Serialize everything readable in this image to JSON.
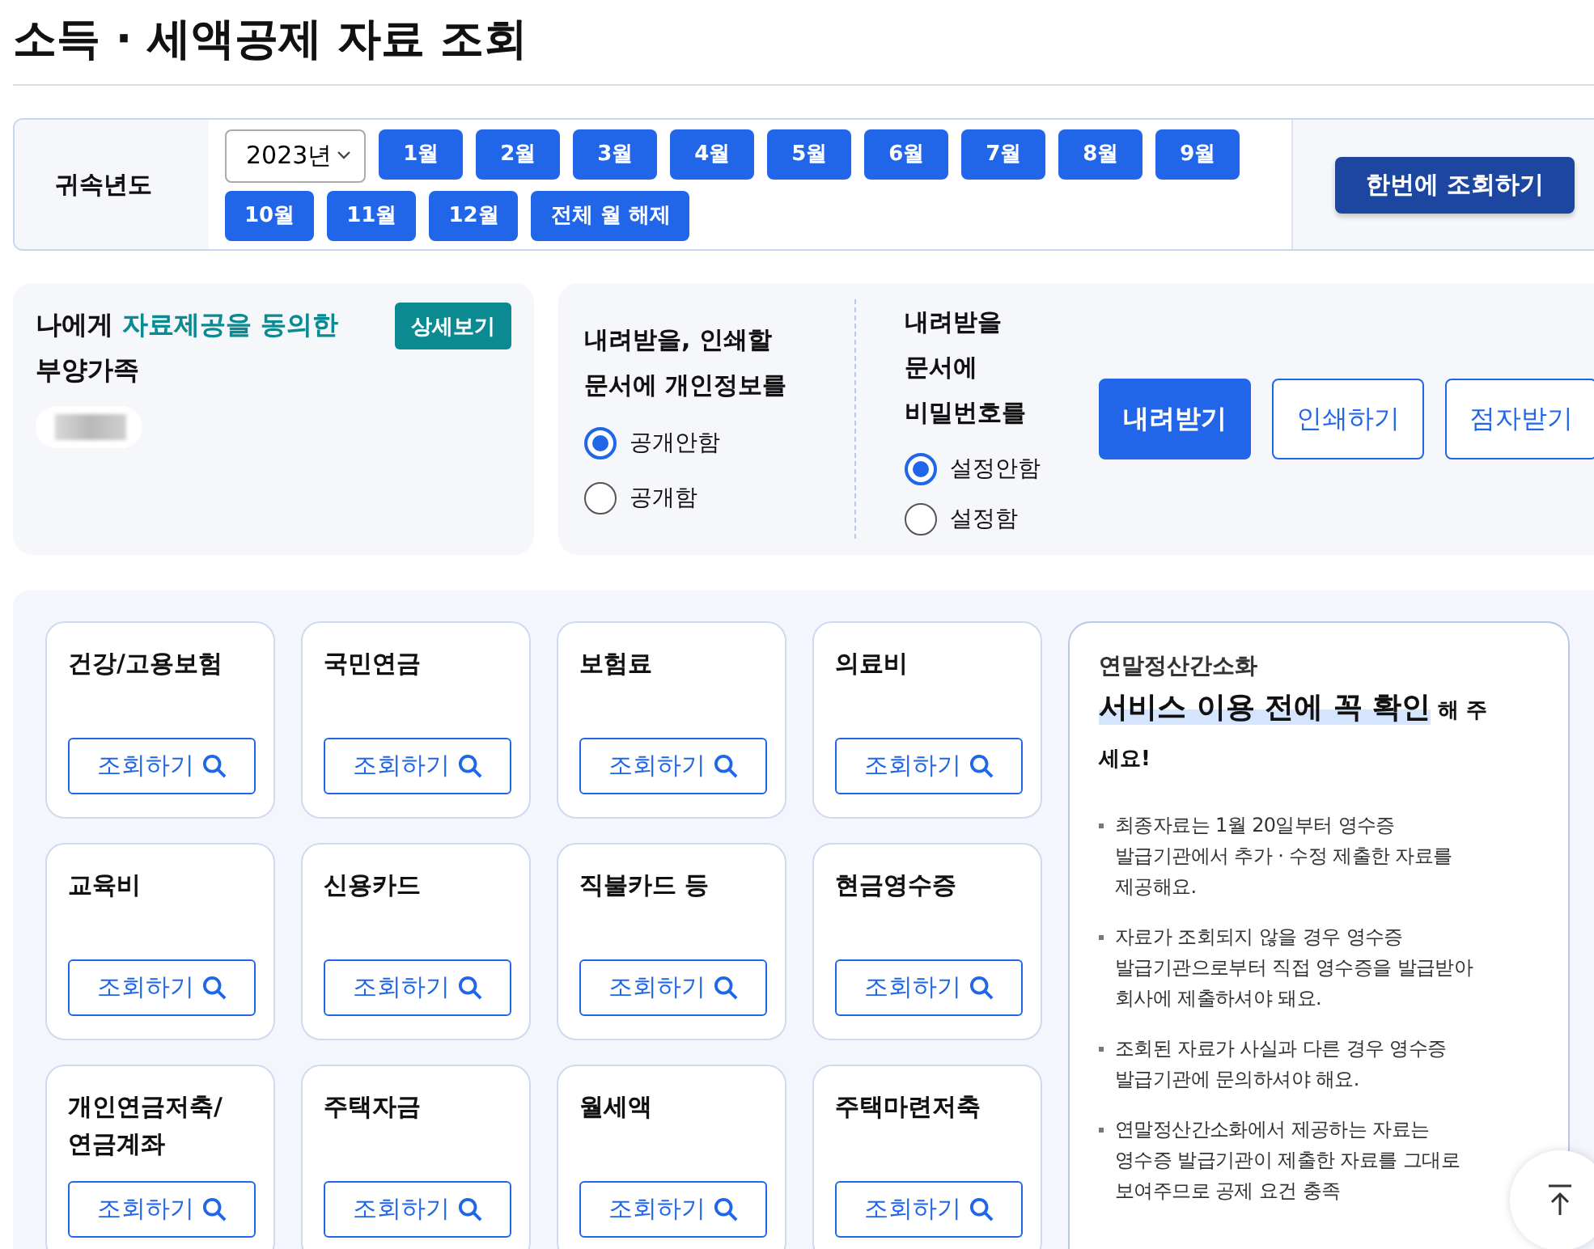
{
  "page_title": "소득 · 세액공제 자료 조회",
  "year_filter": {
    "label": "귀속년도",
    "year": "2023년",
    "months": [
      "1월",
      "2월",
      "3월",
      "4월",
      "5월",
      "6월",
      "7월",
      "8월",
      "9월",
      "10월",
      "11월",
      "12월"
    ],
    "clear_button": "전체 월 해제",
    "search_all_button": "한번에 조회하기"
  },
  "dependents": {
    "title_before": "나에게 ",
    "title_highlight": "자료제공을 동의한",
    "title_after": "부양가족",
    "detail_button": "상세보기"
  },
  "privacy": {
    "question": "내려받을, 인쇄할 문서에 개인정보를",
    "options": [
      {
        "label": "공개안함",
        "selected": true
      },
      {
        "label": "공개함",
        "selected": false
      }
    ]
  },
  "password": {
    "question": "내려받을 문서에 비밀번호를",
    "options": [
      {
        "label": "설정안함",
        "selected": true
      },
      {
        "label": "설정함",
        "selected": false
      }
    ]
  },
  "actions": [
    {
      "label": "내려받기",
      "kind": "primary"
    },
    {
      "label": "인쇄하기",
      "kind": "outline"
    },
    {
      "label": "점자받기",
      "kind": "outline"
    }
  ],
  "categories": [
    {
      "title": "건강/고용보험",
      "button": "조회하기"
    },
    {
      "title": "국민연금",
      "button": "조회하기"
    },
    {
      "title": "보험료",
      "button": "조회하기"
    },
    {
      "title": "의료비",
      "button": "조회하기"
    },
    {
      "title": "교육비",
      "button": "조회하기"
    },
    {
      "title": "신용카드",
      "button": "조회하기"
    },
    {
      "title": "직불카드 등",
      "button": "조회하기"
    },
    {
      "title": "현금영수증",
      "button": "조회하기"
    },
    {
      "title": "개인연금저축/연금계좌",
      "button": "조회하기"
    },
    {
      "title": "주택자금",
      "button": "조회하기"
    },
    {
      "title": "월세액",
      "button": "조회하기"
    },
    {
      "title": "주택마련저축",
      "button": "조회하기"
    }
  ],
  "notice": {
    "subtitle": "연말정산간소화",
    "heading_highlight": "서비스 이용 전에 꼭 확인",
    "heading_rest": " 해 주세요!",
    "items": [
      "최종자료는 1월 20일부터 영수증 발급기관에서 추가 · 수정 제출한 자료를 제공해요.",
      "자료가 조회되지 않을 경우 영수증 발급기관으로부터 직접 영수증을 발급받아 회사에 제출하셔야 돼요.",
      "조회된 자료가 사실과 다른 경우 영수증 발급기관에 문의하셔야 해요.",
      "연말정산간소화에서 제공하는 자료는 영수증 발급기관이 제출한 자료를 그대로 보여주므로 공제 요건 충족"
    ]
  }
}
